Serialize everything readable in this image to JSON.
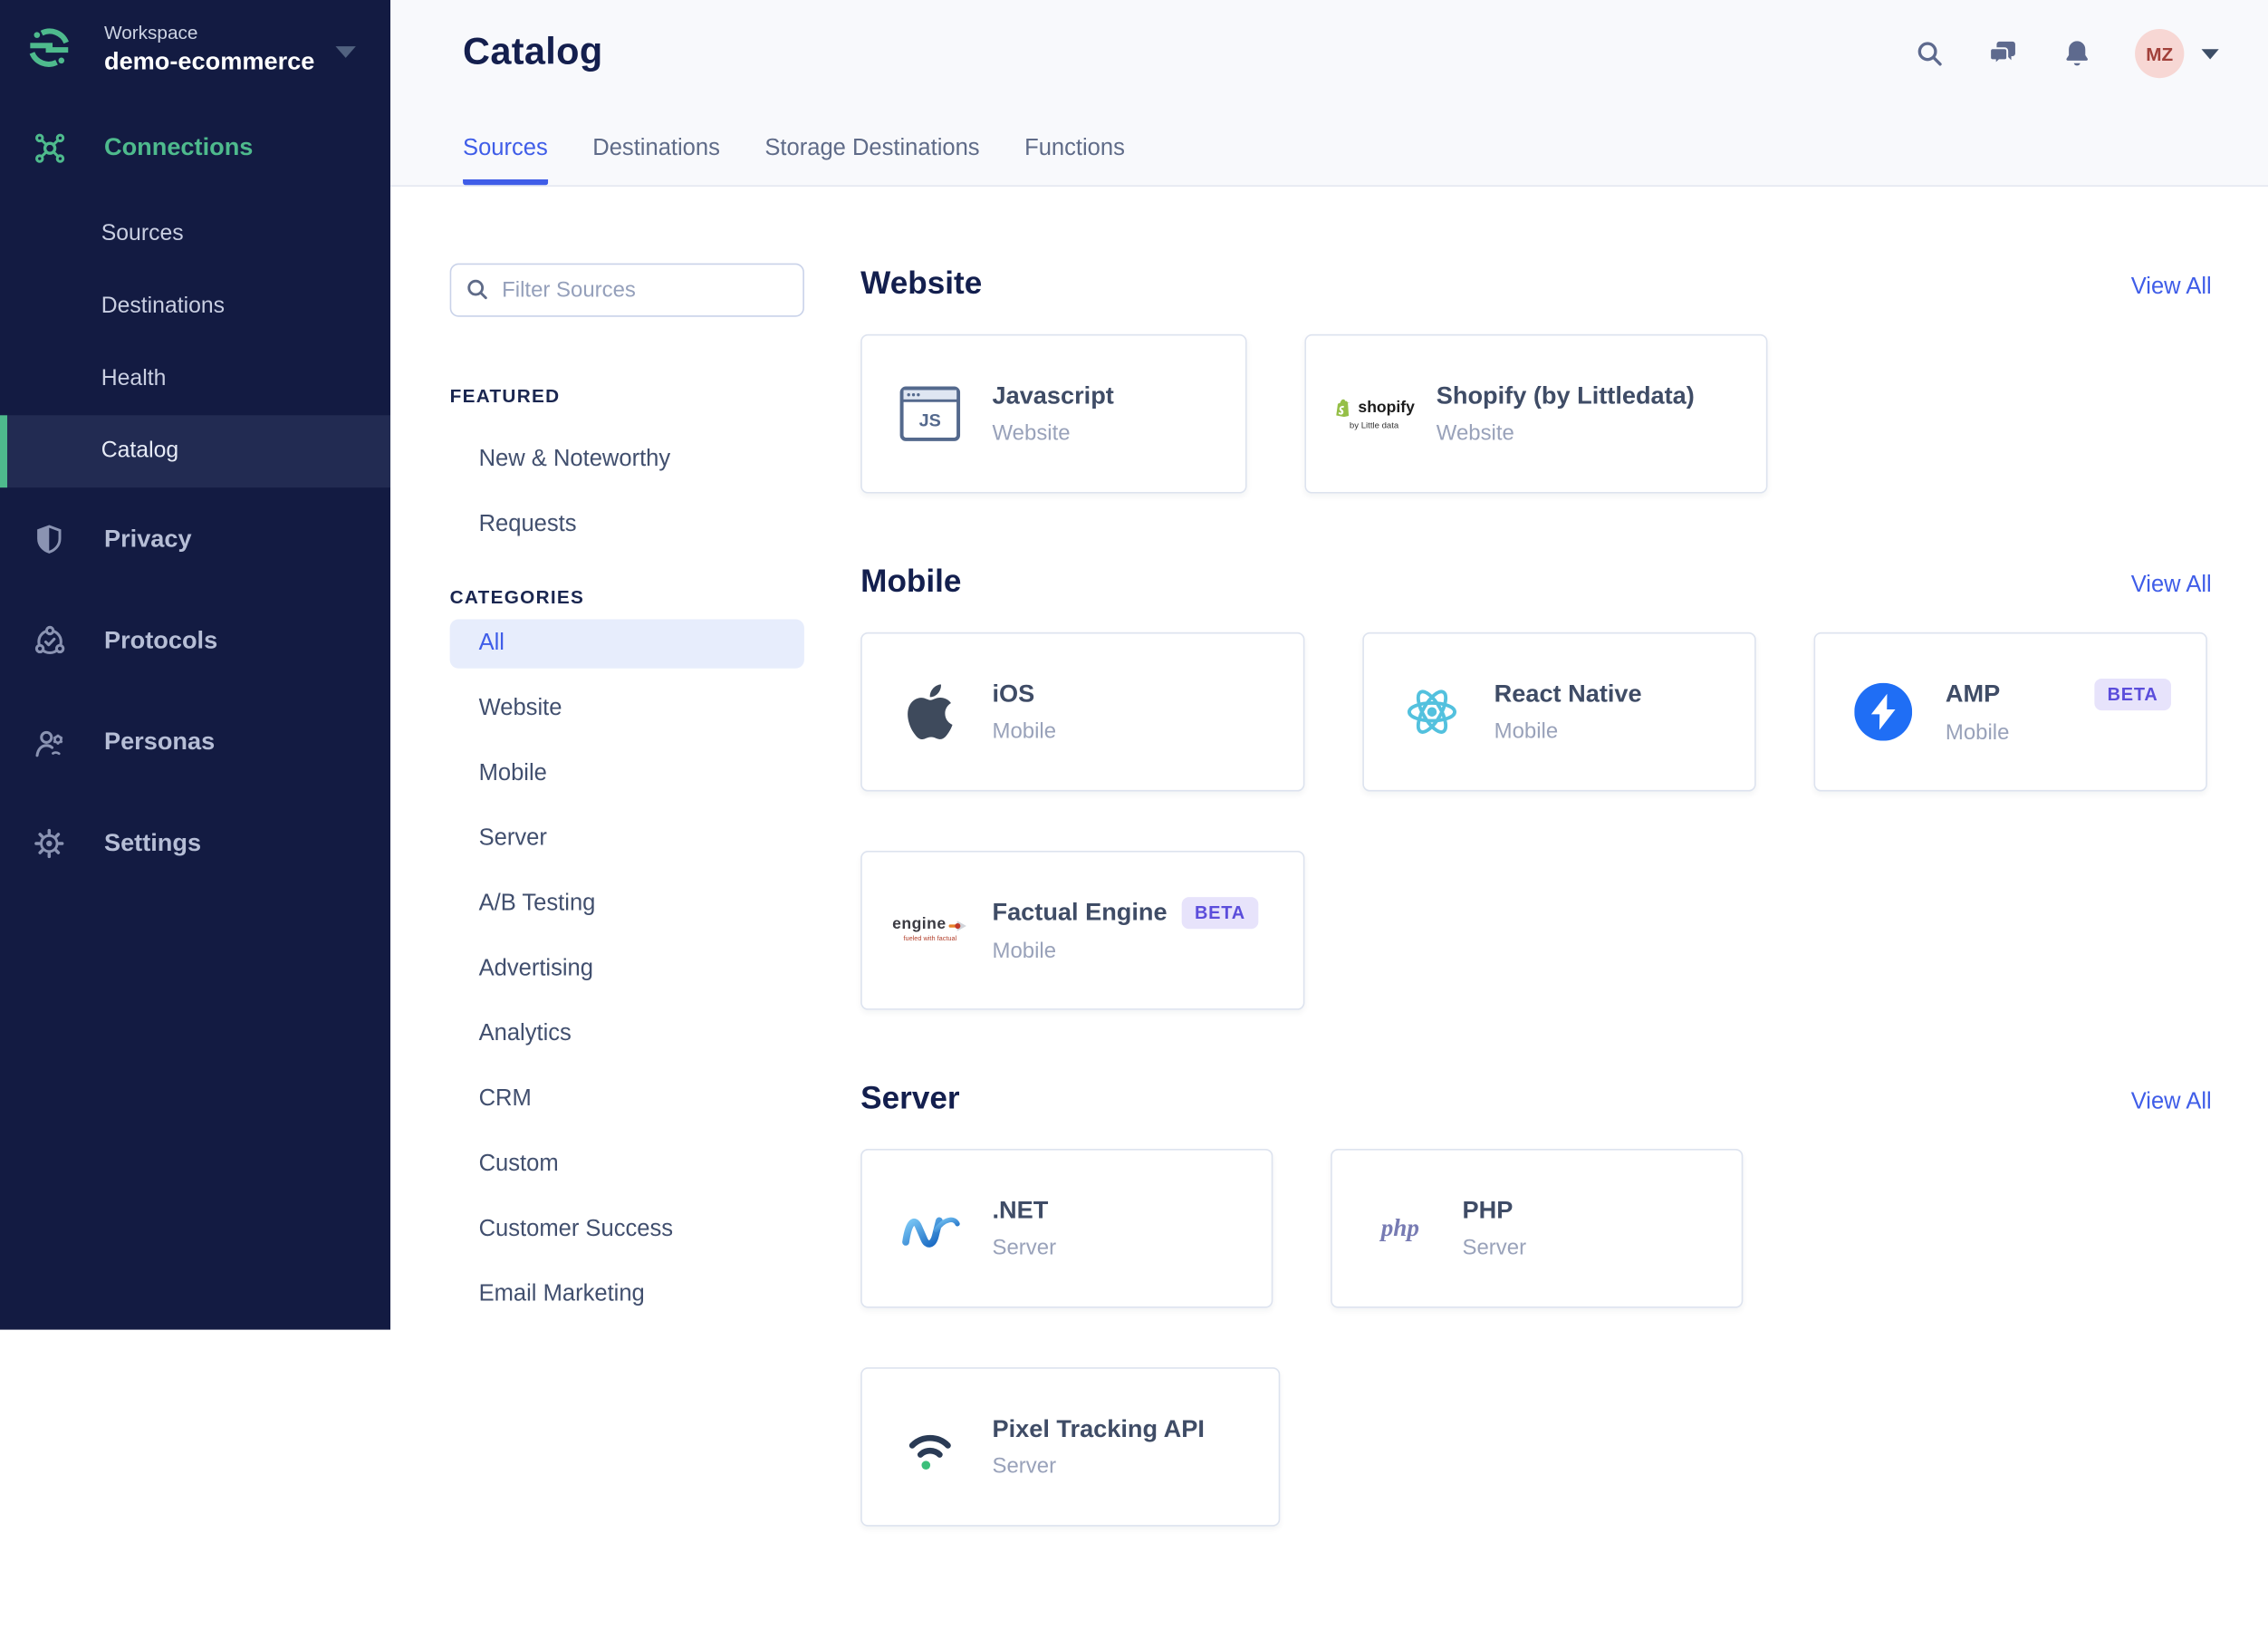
{
  "workspace": {
    "label": "Workspace",
    "name": "demo-ecommerce"
  },
  "sidebar": {
    "connections": {
      "label": "Connections",
      "children": [
        {
          "label": "Sources",
          "active": false
        },
        {
          "label": "Destinations",
          "active": false
        },
        {
          "label": "Health",
          "active": false
        },
        {
          "label": "Catalog",
          "active": true
        }
      ]
    },
    "groups": [
      {
        "label": "Privacy",
        "icon": "shield-icon"
      },
      {
        "label": "Protocols",
        "icon": "protocols-icon"
      },
      {
        "label": "Personas",
        "icon": "personas-icon"
      },
      {
        "label": "Settings",
        "icon": "gear-icon"
      }
    ]
  },
  "header": {
    "title": "Catalog",
    "tabs": [
      {
        "label": "Sources",
        "active": true
      },
      {
        "label": "Destinations",
        "active": false
      },
      {
        "label": "Storage Destinations",
        "active": false
      },
      {
        "label": "Functions",
        "active": false
      }
    ],
    "topbar": {
      "avatar_initials": "MZ"
    }
  },
  "filter": {
    "placeholder": "Filter Sources"
  },
  "featured": {
    "heading": "FEATURED",
    "items": [
      "New & Noteworthy",
      "Requests"
    ]
  },
  "categories": {
    "heading": "CATEGORIES",
    "selected": "All",
    "items": [
      "All",
      "Website",
      "Mobile",
      "Server",
      "A/B Testing",
      "Advertising",
      "Analytics",
      "CRM",
      "Custom",
      "Customer Success",
      "Email Marketing"
    ]
  },
  "sections": [
    {
      "title": "Website",
      "view_all": "View All",
      "cards": [
        {
          "name": "Javascript",
          "category": "Website",
          "icon": "javascript-icon",
          "logo_text": "JS"
        },
        {
          "name": "Shopify (by Littledata)",
          "category": "Website",
          "icon": "shopify-icon",
          "logo_text": "shopify",
          "logo_subtext": "by Little data"
        }
      ]
    },
    {
      "title": "Mobile",
      "view_all": "View All",
      "cards": [
        {
          "name": "iOS",
          "category": "Mobile",
          "icon": "apple-icon"
        },
        {
          "name": "React Native",
          "category": "Mobile",
          "icon": "react-icon"
        },
        {
          "name": "AMP",
          "category": "Mobile",
          "icon": "amp-icon",
          "badge": "BETA"
        },
        {
          "name": "Factual Engine",
          "category": "Mobile",
          "icon": "factual-engine-icon",
          "badge": "BETA",
          "logo_text": "engine",
          "logo_subtext": "fueled with factual"
        }
      ]
    },
    {
      "title": "Server",
      "view_all": "View All",
      "cards": [
        {
          "name": ".NET",
          "category": "Server",
          "icon": "dotnet-icon",
          "logo_text": "N"
        },
        {
          "name": "PHP",
          "category": "Server",
          "icon": "php-icon",
          "logo_text": "php"
        },
        {
          "name": "Pixel Tracking API",
          "category": "Server",
          "icon": "pixel-tracking-icon"
        }
      ]
    }
  ],
  "colors": {
    "accent_green": "#4eba8d",
    "accent_blue": "#3f5de8",
    "sidebar_bg": "#131b42",
    "beta_badge_bg": "#e7e3fb",
    "beta_badge_text": "#5b4ddb",
    "amp_blue": "#1f6ef5",
    "react_cyan": "#53c1de",
    "shopify_green": "#95bf47"
  }
}
